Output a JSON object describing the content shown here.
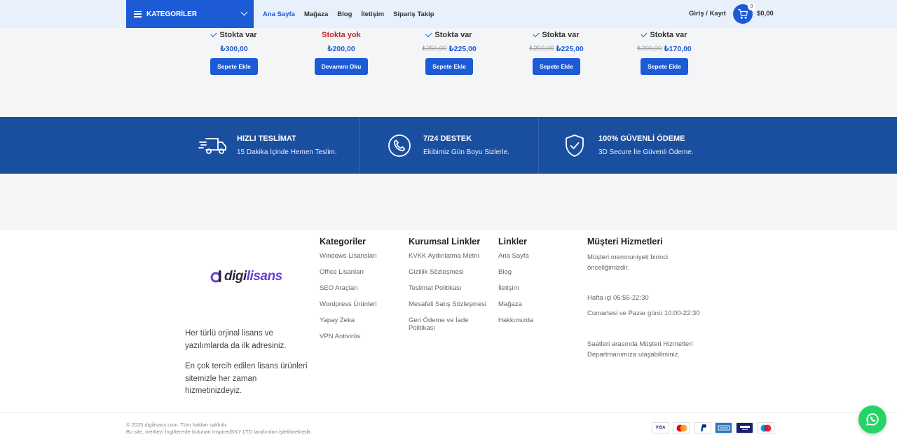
{
  "header": {
    "categories_label": "KATEGORİLER",
    "nav": [
      "Ana Sayfa",
      "Mağaza",
      "Blog",
      "İletişim",
      "Sipariş Takip"
    ],
    "login_label": "Giriş / Kayıt",
    "cart_count": "0",
    "cart_total": "$0,00"
  },
  "products": [
    {
      "stock": "Stokta var",
      "in_stock": true,
      "old_price": "",
      "price": "₺300,00",
      "button": "Sepete Ekle"
    },
    {
      "stock": "Stokta yok",
      "in_stock": false,
      "old_price": "",
      "price": "₺200,00",
      "button": "Devamını Oku"
    },
    {
      "stock": "Stokta var",
      "in_stock": true,
      "old_price": "₺250,00",
      "price": "₺225,00",
      "button": "Sepete Ekle"
    },
    {
      "stock": "Stokta var",
      "in_stock": true,
      "old_price": "₺250,00",
      "price": "₺225,00",
      "button": "Sepete Ekle"
    },
    {
      "stock": "Stokta var",
      "in_stock": true,
      "old_price": "₺200,00",
      "price": "₺170,00",
      "button": "Sepete Ekle"
    }
  ],
  "features": [
    {
      "icon": "truck-icon",
      "title": "HIZLI TESLİMAT",
      "subtitle": "15 Dakika İçinde Hemen Teslim."
    },
    {
      "icon": "phone-icon",
      "title": "7/24 DESTEK",
      "subtitle": "Ekibimiz Gün Boyu Sizlerle."
    },
    {
      "icon": "shield-icon",
      "title": "100% GÜVENLİ ÖDEME",
      "subtitle": "3D Secure İle Güvenli Ödeme."
    }
  ],
  "footer": {
    "logo": {
      "part1": "digi",
      "part2": "lisans"
    },
    "about1": "Her türlü orjinal lisans ve yazılımlarda da ilk adresiniz.",
    "about2": "En çok tercih edilen lisans ürünleri sitemizle her zaman hizmetinizdeyiz.",
    "columns": [
      {
        "title": "Kategoriler",
        "items": [
          "Windows Lisansları",
          "Office Lisanları",
          "SEO Araçları",
          "Wordpress Ürünleri",
          "Yapay Zeka",
          "VPN Antivirüs"
        ]
      },
      {
        "title": "Kurumsal Linkler",
        "items": [
          "KVKK Aydınlatma Metni",
          "Gizlilik Sözleşmesi",
          "Teslimat Politikası",
          "Mesafeli Satış Sözleşmesi",
          "Geri Ödeme ve İade Politikası"
        ]
      },
      {
        "title": "Linkler",
        "items": [
          "Ana Sayfa",
          "Blog",
          "İletişim",
          "Mağaza",
          "Hakkımızda"
        ]
      }
    ],
    "service": {
      "title": "Müşteri Hizmetleri",
      "text1": "Müşteri memnuniyeti birinci önceliğimizdir.",
      "hours1": "Hafta içi 05:55-22:30",
      "hours2": "Cumartesi ve Pazar günü 10:00-22:30",
      "text2": "Saatleri arasında Müşteri Hizmetleri Departmanımıza ulaşabilirsiniz."
    },
    "copyright1": "© 2025 digilisans.com. Tüm hakları saklıdır.",
    "copyright2": "Bu site, merkezi İngiltere'de bulunan InspiredSKY LTD tarafından işletilmektedir.",
    "payments": [
      "VISA",
      "MC",
      "PayPal",
      "AMEX",
      "VISA Electron",
      "Maestro"
    ]
  },
  "colors": {
    "brand": "#1d5bd6",
    "band": "#1a4fa0",
    "whatsapp": "#25d366"
  }
}
